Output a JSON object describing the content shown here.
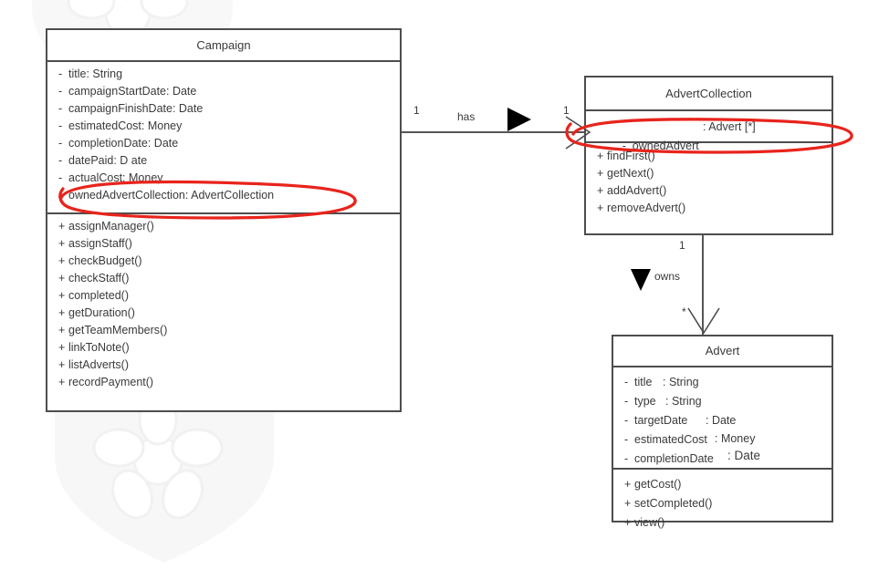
{
  "diagram": {
    "type": "uml-class-diagram",
    "classes": [
      {
        "name": "Campaign",
        "attributes": [
          {
            "visibility": "-",
            "text": "title: String"
          },
          {
            "visibility": "-",
            "text": "campaignStartDate: Date"
          },
          {
            "visibility": "-",
            "text": "campaignFinishDate: Date"
          },
          {
            "visibility": "-",
            "text": "estimatedCost: Money"
          },
          {
            "visibility": "-",
            "text": "completionDate: Date"
          },
          {
            "visibility": "-",
            "text": "datePaid: D ate"
          },
          {
            "visibility": "-",
            "text": "actualCost: Money"
          },
          {
            "visibility": "-",
            "text": "ownedAdvertCollection: AdvertCollection"
          }
        ],
        "operations": [
          {
            "visibility": "+",
            "text": "assignManager()"
          },
          {
            "visibility": "+",
            "text": "assignStaff()"
          },
          {
            "visibility": "+",
            "text": "checkBudget()"
          },
          {
            "visibility": "+",
            "text": "checkStaff()"
          },
          {
            "visibility": "+",
            "text": "completed()"
          },
          {
            "visibility": "+",
            "text": "getDuration()"
          },
          {
            "visibility": "+",
            "text": "getTeamMembers()"
          },
          {
            "visibility": "+",
            "text": "linkToNote()"
          },
          {
            "visibility": "+",
            "text": "listAdverts()"
          },
          {
            "visibility": "+",
            "text": "recordPayment()"
          }
        ]
      },
      {
        "name": "AdvertCollection",
        "attributes": [
          {
            "visibility": "-",
            "name": "ownedAdvert",
            "type": ": Advert [*]"
          }
        ],
        "operations": [
          {
            "visibility": "+",
            "text": "findFirst()"
          },
          {
            "visibility": "+",
            "text": "getNext()"
          },
          {
            "visibility": "+",
            "text": "addAdvert()"
          },
          {
            "visibility": "+",
            "text": "removeAdvert()"
          }
        ]
      },
      {
        "name": "Advert",
        "attributes": [
          {
            "visibility": "-",
            "name": "title",
            "type": ": String"
          },
          {
            "visibility": "-",
            "name": "type",
            "type": ": String"
          },
          {
            "visibility": "-",
            "name": "targetDate",
            "type": ": Date"
          },
          {
            "visibility": "-",
            "name": "estimatedCost",
            "type": ": Money"
          },
          {
            "visibility": "-",
            "name": "completionDate",
            "type": ": Date"
          }
        ],
        "operations": [
          {
            "visibility": "+",
            "text": "getCost()"
          },
          {
            "visibility": "+",
            "text": "setCompleted()"
          },
          {
            "visibility": "+",
            "text": "view()"
          }
        ]
      }
    ],
    "associations": [
      {
        "id": "campaign-has-advertcollection",
        "label": "has",
        "source_multiplicity": "1",
        "target_multiplicity": "1",
        "direction": "right"
      },
      {
        "id": "advertcollection-owns-advert",
        "label": "owns",
        "source_multiplicity": "1",
        "target_multiplicity": "*",
        "direction": "down"
      }
    ],
    "annotations": [
      {
        "id": "ellipse-owned-advert-collection",
        "color": "#e8241c",
        "targets": "Campaign.ownedAdvertCollection: AdvertCollection"
      },
      {
        "id": "ellipse-owned-advert",
        "color": "#e8241c",
        "targets": "AdvertCollection.ownedAdvert : Advert [*]"
      }
    ]
  }
}
